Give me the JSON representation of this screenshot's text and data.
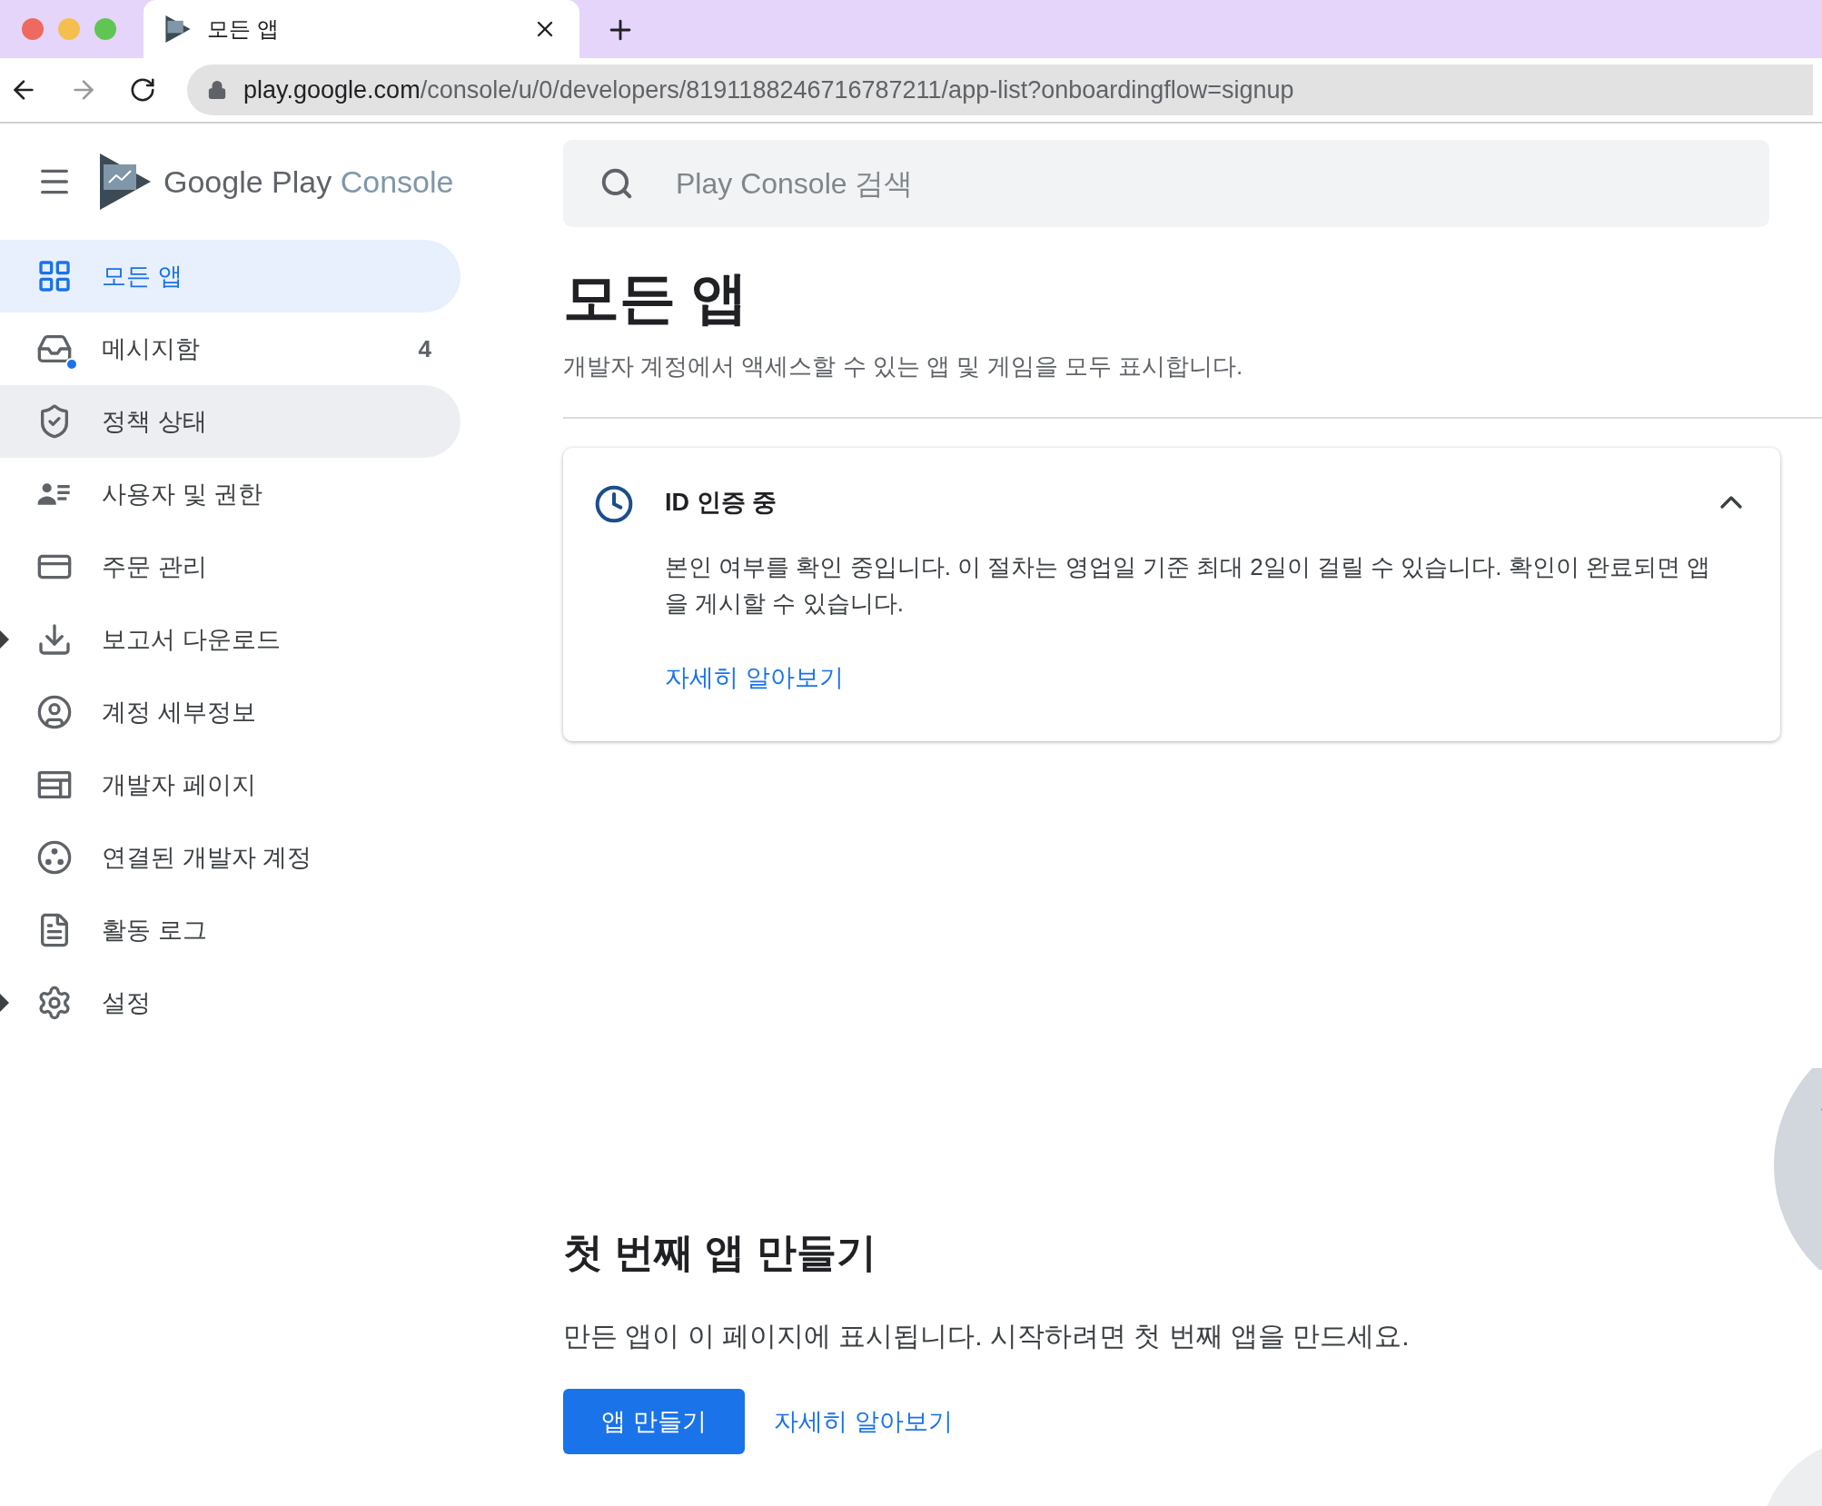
{
  "browser": {
    "tab_title": "모든 앱",
    "url_host": "play.google.com",
    "url_path": "/console/u/0/developers/8191188246716787211/app-list?onboardingflow=signup"
  },
  "header": {
    "logo_text": "Google Play",
    "logo_product": "Console",
    "search_placeholder": "Play Console 검색"
  },
  "sidebar": {
    "items": [
      {
        "label": "모든 앱",
        "selected": true,
        "hovered": false,
        "expandable": false
      },
      {
        "label": "메시지함",
        "selected": false,
        "hovered": false,
        "expandable": false,
        "badge": "4",
        "unread": true
      },
      {
        "label": "정책 상태",
        "selected": false,
        "hovered": true,
        "expandable": false
      },
      {
        "label": "사용자 및 권한",
        "selected": false,
        "hovered": false,
        "expandable": false
      },
      {
        "label": "주문 관리",
        "selected": false,
        "hovered": false,
        "expandable": false
      },
      {
        "label": "보고서 다운로드",
        "selected": false,
        "hovered": false,
        "expandable": true
      },
      {
        "label": "계정 세부정보",
        "selected": false,
        "hovered": false,
        "expandable": false
      },
      {
        "label": "개발자 페이지",
        "selected": false,
        "hovered": false,
        "expandable": false
      },
      {
        "label": "연결된 개발자 계정",
        "selected": false,
        "hovered": false,
        "expandable": false
      },
      {
        "label": "활동 로그",
        "selected": false,
        "hovered": false,
        "expandable": false
      },
      {
        "label": "설정",
        "selected": false,
        "hovered": false,
        "expandable": true
      }
    ]
  },
  "page": {
    "title": "모든 앱",
    "subtitle": "개발자 계정에서 액세스할 수 있는 앱 및 게임을 모두 표시합니다."
  },
  "notice": {
    "title": "ID 인증 중",
    "expanded": true,
    "body": "본인 여부를 확인 중입니다. 이 절차는 영업일 기준 최대 2일이 걸릴 수 있습니다. 확인이 완료되면 앱을 게시할 수 있습니다.",
    "link": "자세히 알아보기"
  },
  "empty_state": {
    "title": "첫 번째 앱 만들기",
    "text": "만든 앱이 이 페이지에 표시됩니다. 시작하려면 첫 번째 앱을 만드세요.",
    "button": "앱 만들기",
    "link": "자세히 알아보기"
  }
}
